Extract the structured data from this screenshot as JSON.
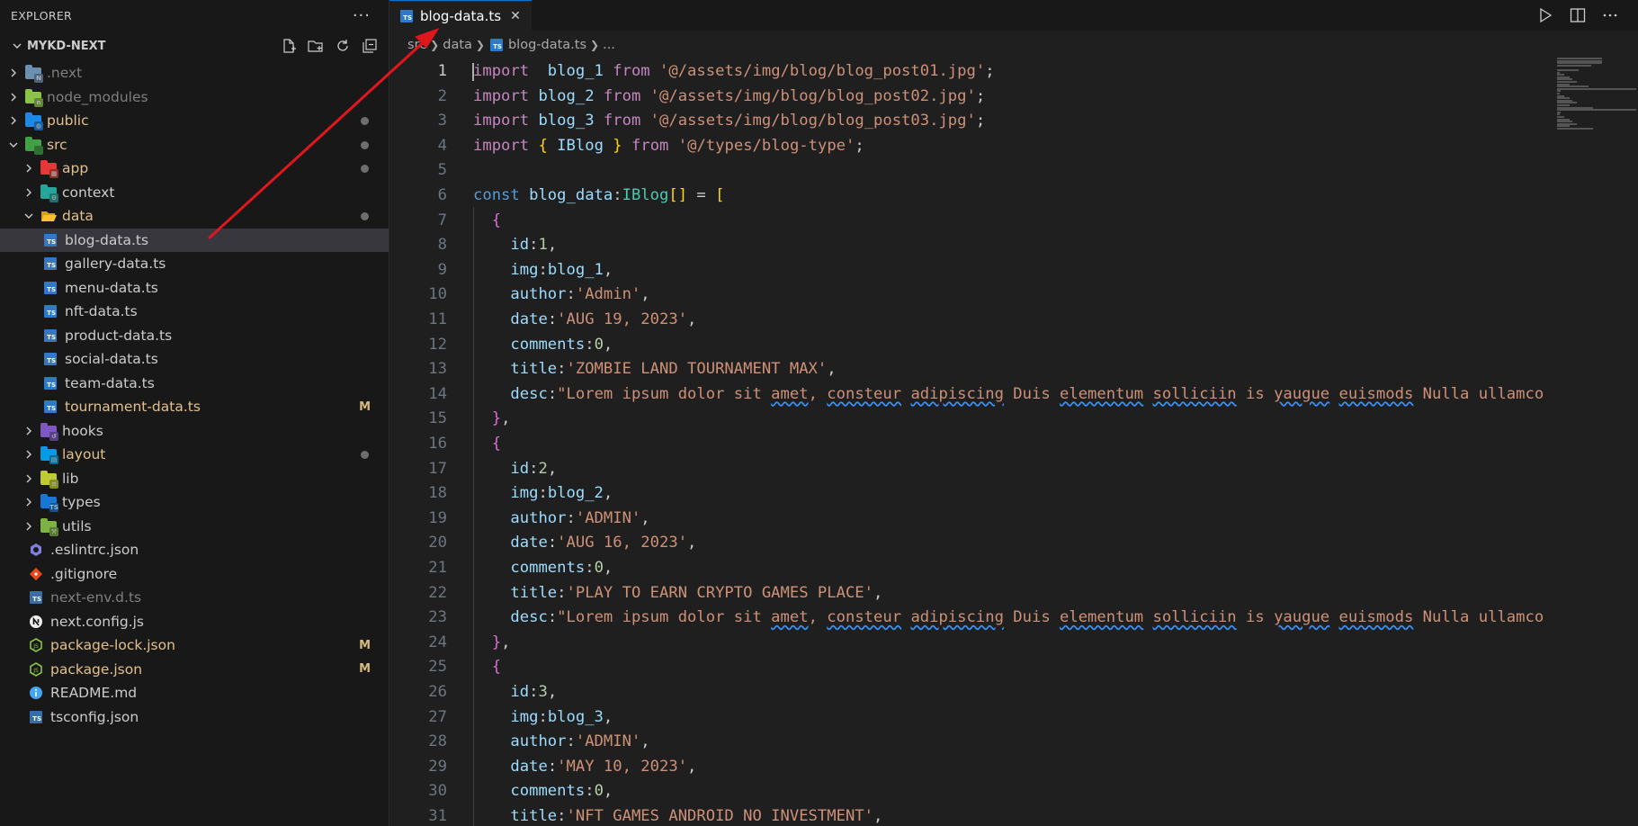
{
  "explorer": {
    "title": "EXPLORER",
    "more": "···",
    "project": "MYKD-NEXT"
  },
  "tree": [
    {
      "label": ".next",
      "kind": "folder",
      "depth": 0,
      "open": false,
      "color": "#6b8fb0",
      "style": "ign",
      "dot": false,
      "badge": ""
    },
    {
      "label": "node_modules",
      "kind": "folder",
      "depth": 0,
      "open": false,
      "color": "#8bc34a",
      "style": "ign",
      "dot": false,
      "badge": ""
    },
    {
      "label": "public",
      "kind": "folder",
      "depth": 0,
      "open": false,
      "color": "#1e88e5",
      "style": "mod",
      "dot": true,
      "badge": ""
    },
    {
      "label": "src",
      "kind": "folder",
      "depth": 0,
      "open": true,
      "color": "#43a047",
      "style": "mod",
      "dot": true,
      "badge": ""
    },
    {
      "label": "app",
      "kind": "folder",
      "depth": 1,
      "open": false,
      "color": "#e53935",
      "style": "mod",
      "dot": true,
      "badge": ""
    },
    {
      "label": "context",
      "kind": "folder",
      "depth": 1,
      "open": false,
      "color": "#26a69a",
      "style": "",
      "dot": false,
      "badge": ""
    },
    {
      "label": "data",
      "kind": "folder",
      "depth": 1,
      "open": true,
      "color": "#fbc02d",
      "style": "mod",
      "dot": true,
      "badge": ""
    },
    {
      "label": "blog-data.ts",
      "kind": "ts",
      "depth": 2,
      "style": "",
      "selected": true,
      "dot": false,
      "badge": ""
    },
    {
      "label": "gallery-data.ts",
      "kind": "ts",
      "depth": 2,
      "style": "",
      "dot": false,
      "badge": ""
    },
    {
      "label": "menu-data.ts",
      "kind": "ts",
      "depth": 2,
      "style": "",
      "dot": false,
      "badge": ""
    },
    {
      "label": "nft-data.ts",
      "kind": "ts",
      "depth": 2,
      "style": "",
      "dot": false,
      "badge": ""
    },
    {
      "label": "product-data.ts",
      "kind": "ts",
      "depth": 2,
      "style": "",
      "dot": false,
      "badge": ""
    },
    {
      "label": "social-data.ts",
      "kind": "ts",
      "depth": 2,
      "style": "",
      "dot": false,
      "badge": ""
    },
    {
      "label": "team-data.ts",
      "kind": "ts",
      "depth": 2,
      "style": "",
      "dot": false,
      "badge": ""
    },
    {
      "label": "tournament-data.ts",
      "kind": "ts",
      "depth": 2,
      "style": "mod",
      "dot": false,
      "badge": "M"
    },
    {
      "label": "hooks",
      "kind": "folder",
      "depth": 1,
      "open": false,
      "color": "#7e57c2",
      "style": "",
      "dot": false,
      "badge": ""
    },
    {
      "label": "layout",
      "kind": "folder",
      "depth": 1,
      "open": false,
      "color": "#039be5",
      "style": "mod",
      "dot": true,
      "badge": ""
    },
    {
      "label": "lib",
      "kind": "folder",
      "depth": 1,
      "open": false,
      "color": "#c0ca33",
      "style": "",
      "dot": false,
      "badge": ""
    },
    {
      "label": "types",
      "kind": "folder",
      "depth": 1,
      "open": false,
      "color": "#1976d2",
      "style": "",
      "dot": false,
      "badge": ""
    },
    {
      "label": "utils",
      "kind": "folder",
      "depth": 1,
      "open": false,
      "color": "#7cb342",
      "style": "",
      "dot": false,
      "badge": ""
    },
    {
      "label": ".eslintrc.json",
      "kind": "eslint",
      "depth": 0,
      "style": "",
      "dot": false,
      "badge": ""
    },
    {
      "label": ".gitignore",
      "kind": "git",
      "depth": 0,
      "style": "",
      "dot": false,
      "badge": ""
    },
    {
      "label": "next-env.d.ts",
      "kind": "tsd",
      "depth": 0,
      "style": "ign",
      "dot": false,
      "badge": ""
    },
    {
      "label": "next.config.js",
      "kind": "next",
      "depth": 0,
      "style": "",
      "dot": false,
      "badge": ""
    },
    {
      "label": "package-lock.json",
      "kind": "node",
      "depth": 0,
      "style": "mod",
      "dot": false,
      "badge": "M"
    },
    {
      "label": "package.json",
      "kind": "node",
      "depth": 0,
      "style": "mod",
      "dot": false,
      "badge": "M"
    },
    {
      "label": "README.md",
      "kind": "info",
      "depth": 0,
      "style": "",
      "dot": false,
      "badge": ""
    },
    {
      "label": "tsconfig.json",
      "kind": "tsconfig",
      "depth": 0,
      "style": "",
      "dot": false,
      "badge": ""
    }
  ],
  "editor": {
    "tab_label": "blog-data.ts",
    "tab_close": "✕",
    "breadcrumb": [
      "src",
      "data",
      "blog-data.ts",
      "..."
    ]
  },
  "code": [
    [
      [
        "k",
        "import"
      ],
      [
        "",
        "  "
      ],
      [
        "v",
        "blog_1"
      ],
      [
        "",
        " "
      ],
      [
        "k",
        "from"
      ],
      [
        "",
        " "
      ],
      [
        "s",
        "'@/assets/img/blog/blog_post01.jpg'"
      ],
      [
        "",
        ";"
      ]
    ],
    [
      [
        "k",
        "import"
      ],
      [
        "",
        " "
      ],
      [
        "v",
        "blog_2"
      ],
      [
        "",
        " "
      ],
      [
        "k",
        "from"
      ],
      [
        "",
        " "
      ],
      [
        "s",
        "'@/assets/img/blog/blog_post02.jpg'"
      ],
      [
        "",
        ";"
      ]
    ],
    [
      [
        "k",
        "import"
      ],
      [
        "",
        " "
      ],
      [
        "v",
        "blog_3"
      ],
      [
        "",
        " "
      ],
      [
        "k",
        "from"
      ],
      [
        "",
        " "
      ],
      [
        "s",
        "'@/assets/img/blog/blog_post03.jpg'"
      ],
      [
        "",
        ";"
      ]
    ],
    [
      [
        "k",
        "import"
      ],
      [
        "",
        " "
      ],
      [
        "p1",
        "{"
      ],
      [
        "",
        " "
      ],
      [
        "v",
        "IBlog"
      ],
      [
        "",
        " "
      ],
      [
        "p1",
        "}"
      ],
      [
        "",
        " "
      ],
      [
        "k",
        "from"
      ],
      [
        "",
        " "
      ],
      [
        "s",
        "'@/types/blog-type'"
      ],
      [
        "",
        ";"
      ]
    ],
    [],
    [
      [
        "kb",
        "const"
      ],
      [
        "",
        " "
      ],
      [
        "v",
        "blog_data"
      ],
      [
        "",
        ":"
      ],
      [
        "t",
        "IBlog"
      ],
      [
        "p1",
        "[]"
      ],
      [
        "",
        " = "
      ],
      [
        "p1",
        "["
      ]
    ],
    [
      [
        "",
        "  "
      ],
      [
        "p2",
        "{"
      ]
    ],
    [
      [
        "",
        "    "
      ],
      [
        "v",
        "id"
      ],
      [
        "",
        ":"
      ],
      [
        "n",
        "1"
      ],
      [
        "",
        ","
      ]
    ],
    [
      [
        "",
        "    "
      ],
      [
        "v",
        "img"
      ],
      [
        "",
        ":"
      ],
      [
        "v",
        "blog_1"
      ],
      [
        "",
        ","
      ]
    ],
    [
      [
        "",
        "    "
      ],
      [
        "v",
        "author"
      ],
      [
        "",
        ":"
      ],
      [
        "s",
        "'Admin'"
      ],
      [
        "",
        ","
      ]
    ],
    [
      [
        "",
        "    "
      ],
      [
        "v",
        "date"
      ],
      [
        "",
        ":"
      ],
      [
        "s",
        "'AUG 19, 2023'"
      ],
      [
        "",
        ","
      ]
    ],
    [
      [
        "",
        "    "
      ],
      [
        "v",
        "comments"
      ],
      [
        "",
        ":"
      ],
      [
        "n",
        "0"
      ],
      [
        "",
        ","
      ]
    ],
    [
      [
        "",
        "    "
      ],
      [
        "v",
        "title"
      ],
      [
        "",
        ":"
      ],
      [
        "s",
        "'ZOMBIE LAND TOURNAMENT MAX'"
      ],
      [
        "",
        ","
      ]
    ],
    [
      [
        "",
        "    "
      ],
      [
        "v",
        "desc"
      ],
      [
        "",
        ":"
      ],
      [
        "s",
        "\"Lorem ipsum dolor sit "
      ],
      [
        "s sq",
        "amet"
      ],
      [
        "s",
        ", "
      ],
      [
        "s sq",
        "consteur"
      ],
      [
        "s",
        " "
      ],
      [
        "s sq",
        "adipiscing"
      ],
      [
        "s",
        " Duis "
      ],
      [
        "s sq",
        "elementum"
      ],
      [
        "s",
        " "
      ],
      [
        "s sq",
        "solliciin"
      ],
      [
        "s",
        " is "
      ],
      [
        "s sq",
        "yaugue"
      ],
      [
        "s",
        " "
      ],
      [
        "s sq",
        "euismods"
      ],
      [
        "s",
        " Nulla ullamcorper"
      ]
    ],
    [
      [
        "",
        "  "
      ],
      [
        "p2",
        "}"
      ],
      [
        "",
        ","
      ]
    ],
    [
      [
        "",
        "  "
      ],
      [
        "p2",
        "{"
      ]
    ],
    [
      [
        "",
        "    "
      ],
      [
        "v",
        "id"
      ],
      [
        "",
        ":"
      ],
      [
        "n",
        "2"
      ],
      [
        "",
        ","
      ]
    ],
    [
      [
        "",
        "    "
      ],
      [
        "v",
        "img"
      ],
      [
        "",
        ":"
      ],
      [
        "v",
        "blog_2"
      ],
      [
        "",
        ","
      ]
    ],
    [
      [
        "",
        "    "
      ],
      [
        "v",
        "author"
      ],
      [
        "",
        ":"
      ],
      [
        "s",
        "'ADMIN'"
      ],
      [
        "",
        ","
      ]
    ],
    [
      [
        "",
        "    "
      ],
      [
        "v",
        "date"
      ],
      [
        "",
        ":"
      ],
      [
        "s",
        "'AUG 16, 2023'"
      ],
      [
        "",
        ","
      ]
    ],
    [
      [
        "",
        "    "
      ],
      [
        "v",
        "comments"
      ],
      [
        "",
        ":"
      ],
      [
        "n",
        "0"
      ],
      [
        "",
        ","
      ]
    ],
    [
      [
        "",
        "    "
      ],
      [
        "v",
        "title"
      ],
      [
        "",
        ":"
      ],
      [
        "s",
        "'PLAY TO EARN CRYPTO GAMES PLACE'"
      ],
      [
        "",
        ","
      ]
    ],
    [
      [
        "",
        "    "
      ],
      [
        "v",
        "desc"
      ],
      [
        "",
        ":"
      ],
      [
        "s",
        "\"Lorem ipsum dolor sit "
      ],
      [
        "s sq",
        "amet"
      ],
      [
        "s",
        ", "
      ],
      [
        "s sq",
        "consteur"
      ],
      [
        "s",
        " "
      ],
      [
        "s sq",
        "adipiscing"
      ],
      [
        "s",
        " Duis "
      ],
      [
        "s sq",
        "elementum"
      ],
      [
        "s",
        " "
      ],
      [
        "s sq",
        "solliciin"
      ],
      [
        "s",
        " is "
      ],
      [
        "s sq",
        "yaugue"
      ],
      [
        "s",
        " "
      ],
      [
        "s sq",
        "euismods"
      ],
      [
        "s",
        " Nulla ullamcorper"
      ]
    ],
    [
      [
        "",
        "  "
      ],
      [
        "p2",
        "}"
      ],
      [
        "",
        ","
      ]
    ],
    [
      [
        "",
        "  "
      ],
      [
        "p2",
        "{"
      ]
    ],
    [
      [
        "",
        "    "
      ],
      [
        "v",
        "id"
      ],
      [
        "",
        ":"
      ],
      [
        "n",
        "3"
      ],
      [
        "",
        ","
      ]
    ],
    [
      [
        "",
        "    "
      ],
      [
        "v",
        "img"
      ],
      [
        "",
        ":"
      ],
      [
        "v",
        "blog_3"
      ],
      [
        "",
        ","
      ]
    ],
    [
      [
        "",
        "    "
      ],
      [
        "v",
        "author"
      ],
      [
        "",
        ":"
      ],
      [
        "s",
        "'ADMIN'"
      ],
      [
        "",
        ","
      ]
    ],
    [
      [
        "",
        "    "
      ],
      [
        "v",
        "date"
      ],
      [
        "",
        ":"
      ],
      [
        "s",
        "'MAY 10, 2023'"
      ],
      [
        "",
        ","
      ]
    ],
    [
      [
        "",
        "    "
      ],
      [
        "v",
        "comments"
      ],
      [
        "",
        ":"
      ],
      [
        "n",
        "0"
      ],
      [
        "",
        ","
      ]
    ],
    [
      [
        "",
        "    "
      ],
      [
        "v",
        "title"
      ],
      [
        "",
        ":"
      ],
      [
        "s",
        "'NFT GAMES ANDROID NO INVESTMENT'"
      ],
      [
        "",
        ","
      ]
    ]
  ],
  "colors": {
    "accent": "#0078d4",
    "annotation_arrow": "#e0161d"
  }
}
